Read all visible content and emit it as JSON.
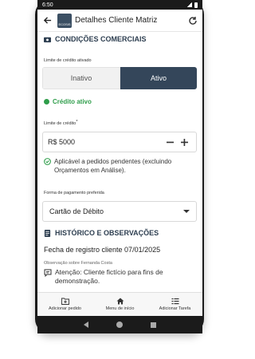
{
  "status": {
    "time": "6:50"
  },
  "appbar": {
    "title": "Detalhes Cliente Matriz",
    "logo_text": "ECOSIS"
  },
  "commercial": {
    "section_title": "CONDIÇÕES COMERCIAIS",
    "credit_limit_activated_label": "Limite de crédito ativado",
    "toggle_inactive": "Inativo",
    "toggle_active": "Ativo",
    "credit_status": "Crédito ativo",
    "credit_limit_label": "Limite de crédito",
    "required_mark": "*",
    "credit_limit_value": "R$ 5000",
    "applicable_note": "Aplicável a pedidos pendentes (excluindo Orçamentos em Análise).",
    "payment_label": "Forma de pagamento preferida",
    "payment_value": "Cartão de Débito"
  },
  "history": {
    "section_title": "HISTÓRICO E OBSERVAÇÕES",
    "register_date": "Fecha de registro cliente  07/01/2025",
    "note_caption": "Observação sobre Fernanda Costa",
    "note_text": "Atenção: Cliente fictício para fins de demonstração."
  },
  "bottomnav": {
    "add_order": "Adicionar pedido",
    "home_menu": "Menu de início",
    "add_task": "Adicionar Tarefa"
  },
  "colors": {
    "primary": "#34465a",
    "success": "#2e9d4a"
  }
}
